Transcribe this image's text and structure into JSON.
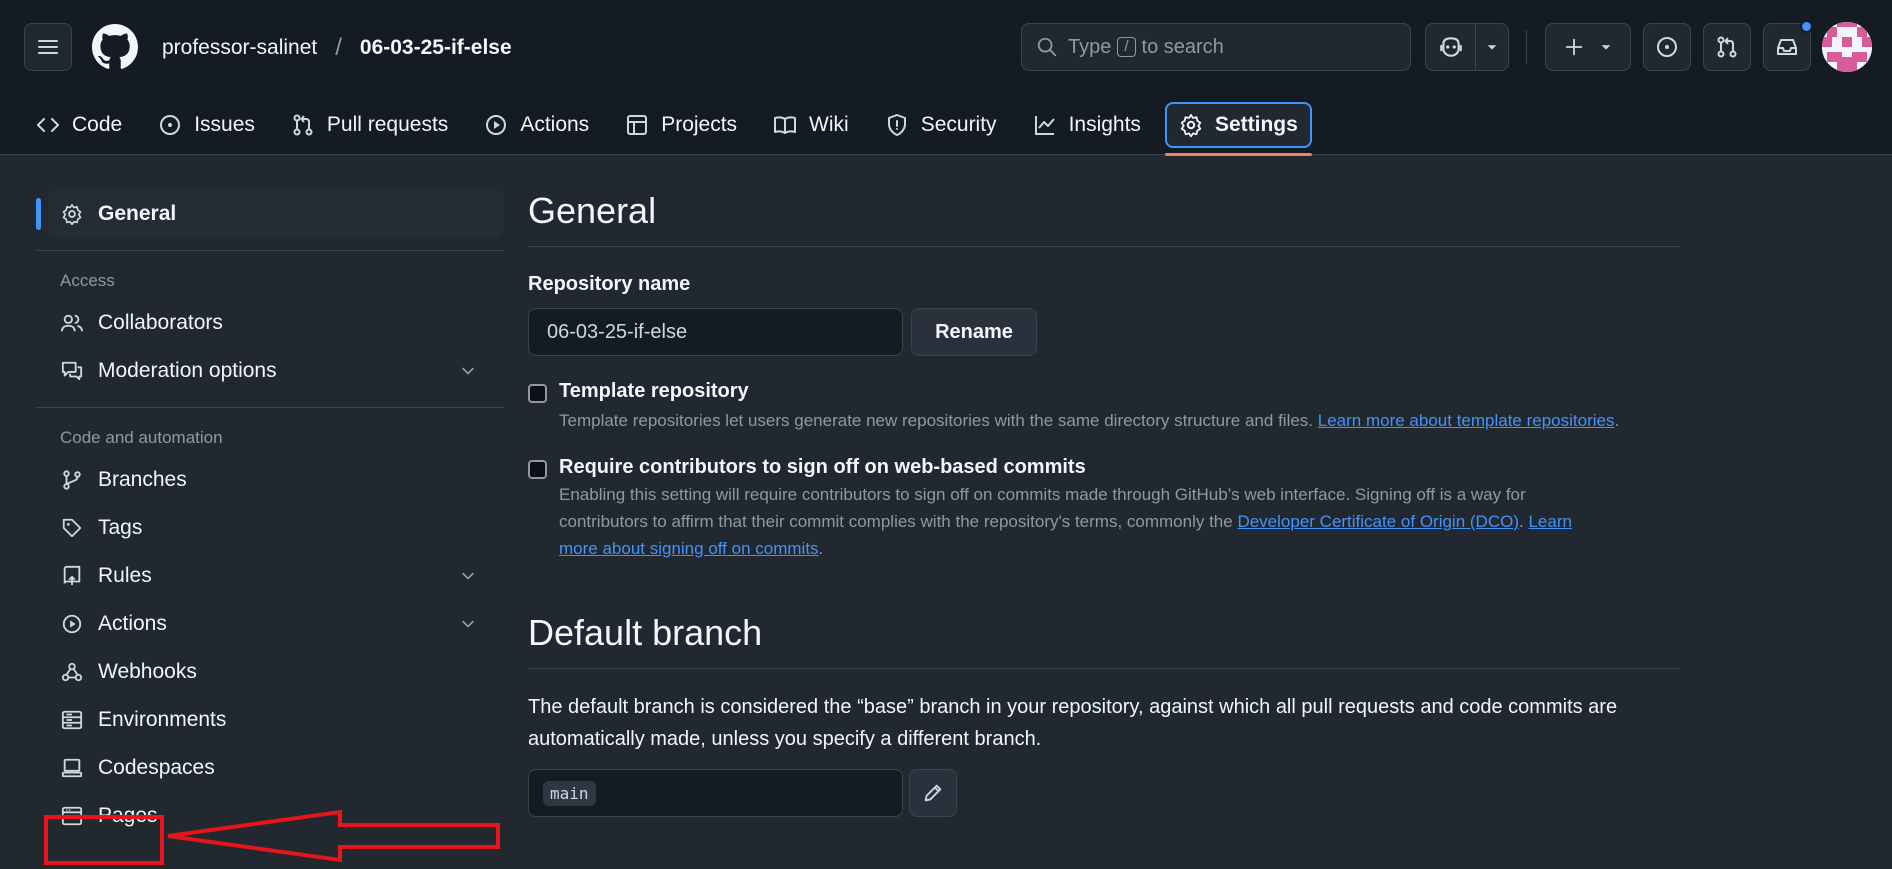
{
  "header": {
    "owner": "professor-salinet",
    "separator": "/",
    "repo": "06-03-25-if-else",
    "search": {
      "prefix": "Type",
      "key": "/",
      "suffix": "to search"
    },
    "icons": [
      "menu-icon",
      "github-logo-icon",
      "search-icon",
      "copilot-icon",
      "chevron-down-icon",
      "plus-icon",
      "issue-opened-icon",
      "git-pull-request-icon",
      "inbox-icon"
    ]
  },
  "tabs": [
    {
      "label": "Code",
      "icon": "code-icon"
    },
    {
      "label": "Issues",
      "icon": "issue-opened-icon"
    },
    {
      "label": "Pull requests",
      "icon": "git-pull-request-icon"
    },
    {
      "label": "Actions",
      "icon": "play-icon"
    },
    {
      "label": "Projects",
      "icon": "table-icon"
    },
    {
      "label": "Wiki",
      "icon": "book-icon"
    },
    {
      "label": "Security",
      "icon": "shield-icon"
    },
    {
      "label": "Insights",
      "icon": "graph-icon"
    },
    {
      "label": "Settings",
      "icon": "gear-icon",
      "selected": true
    }
  ],
  "sidebar": {
    "general": "General",
    "access_heading": "Access",
    "access": [
      {
        "label": "Collaborators",
        "icon": "people-icon"
      },
      {
        "label": "Moderation options",
        "icon": "comment-discussion-icon",
        "expandable": true
      }
    ],
    "code_heading": "Code and automation",
    "code": [
      {
        "label": "Branches",
        "icon": "git-branch-icon"
      },
      {
        "label": "Tags",
        "icon": "tag-icon"
      },
      {
        "label": "Rules",
        "icon": "repo-push-icon",
        "expandable": true
      },
      {
        "label": "Actions",
        "icon": "play-icon",
        "expandable": true
      },
      {
        "label": "Webhooks",
        "icon": "webhook-icon"
      },
      {
        "label": "Environments",
        "icon": "server-icon"
      },
      {
        "label": "Codespaces",
        "icon": "codespaces-icon"
      },
      {
        "label": "Pages",
        "icon": "browser-icon"
      }
    ]
  },
  "main": {
    "general_title": "General",
    "repo_name_label": "Repository name",
    "repo_name_value": "06-03-25-if-else",
    "rename_button": "Rename",
    "template": {
      "title": "Template repository",
      "desc": "Template repositories let users generate new repositories with the same directory structure and files.",
      "link": "Learn more about template repositories",
      "end": "."
    },
    "signoff": {
      "title": "Require contributors to sign off on web-based commits",
      "desc_line1": "Enabling this setting will require contributors to sign off on commits made through GitHub’s web interface. Signing off is a way for",
      "desc_line2": "contributors to affirm that their commit complies with the repository's terms, commonly the",
      "link1": "Developer Certificate of Origin (DCO)",
      "sep": ".",
      "link2a": "Learn",
      "link2b": "more about signing off on commits",
      "end": "."
    },
    "default_branch_title": "Default branch",
    "default_branch_desc": "The default branch is considered the “base” branch in your repository, against which all pull requests and code commits are automatically made, unless you specify a different branch.",
    "branch_value": "main"
  },
  "colors": {
    "header_bg": "#151b23",
    "page_bg": "#212830",
    "accent": "#4493f8",
    "tab_underline": "#f78166",
    "annotation": "#e5151b"
  }
}
